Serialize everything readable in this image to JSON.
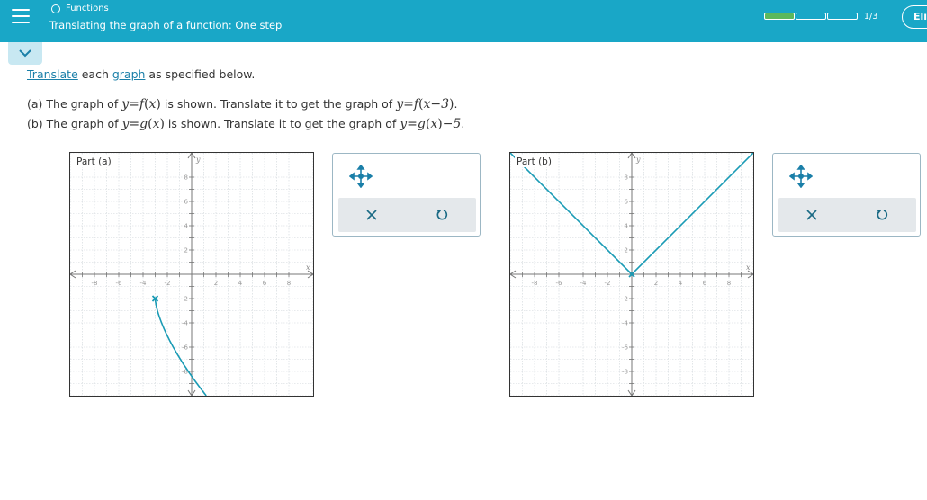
{
  "header": {
    "topic": "Functions",
    "title": "Translating the graph of a function: One step",
    "progress_text": "1/3",
    "progress_done": 1,
    "progress_total": 3,
    "explain_button": "Eli"
  },
  "instructions": {
    "word1": "Translate",
    "middle": " each ",
    "word2": "graph",
    "end": " as specified below."
  },
  "questions": {
    "a": {
      "prefix": "(a) The graph of ",
      "mid": " is shown. Translate it to get the graph of ",
      "end": "."
    },
    "b": {
      "prefix": "(b) The graph of ",
      "mid": " is shown. Translate it to get the graph of ",
      "end": "."
    }
  },
  "math": {
    "a_lhs": "y",
    "a_func": "f",
    "a_var": "x",
    "a_target_lhs": "y",
    "a_target_func": "f",
    "a_target_arg": "x−3",
    "b_lhs": "y",
    "b_func": "g",
    "b_var": "x",
    "b_target_lhs": "y",
    "b_target_func": "g",
    "b_target_var": "x",
    "b_target_shift": "−5"
  },
  "graphs": [
    {
      "label": "Part (a)",
      "x_label": "x",
      "y_label": "y",
      "x_ticks": [
        "-8",
        "-6",
        "-4",
        "-2",
        "2",
        "4",
        "6",
        "8"
      ],
      "y_ticks": [
        "8",
        "6",
        "4",
        "2",
        "-2",
        "-4",
        "-6",
        "-8"
      ],
      "curve_color": "#1a9bb5"
    },
    {
      "label": "Part (b)",
      "x_label": "x",
      "y_label": "y",
      "x_ticks": [
        "-8",
        "-6",
        "-4",
        "-2",
        "2",
        "4",
        "6",
        "8"
      ],
      "y_ticks": [
        "8",
        "6",
        "4",
        "2",
        "-2",
        "-4",
        "-6",
        "-8"
      ],
      "curve_color": "#1a9bb5"
    }
  ],
  "colors": {
    "header_bg": "#19a7c7",
    "accent": "#1a7fa8",
    "progress_done": "#5cb85c"
  }
}
